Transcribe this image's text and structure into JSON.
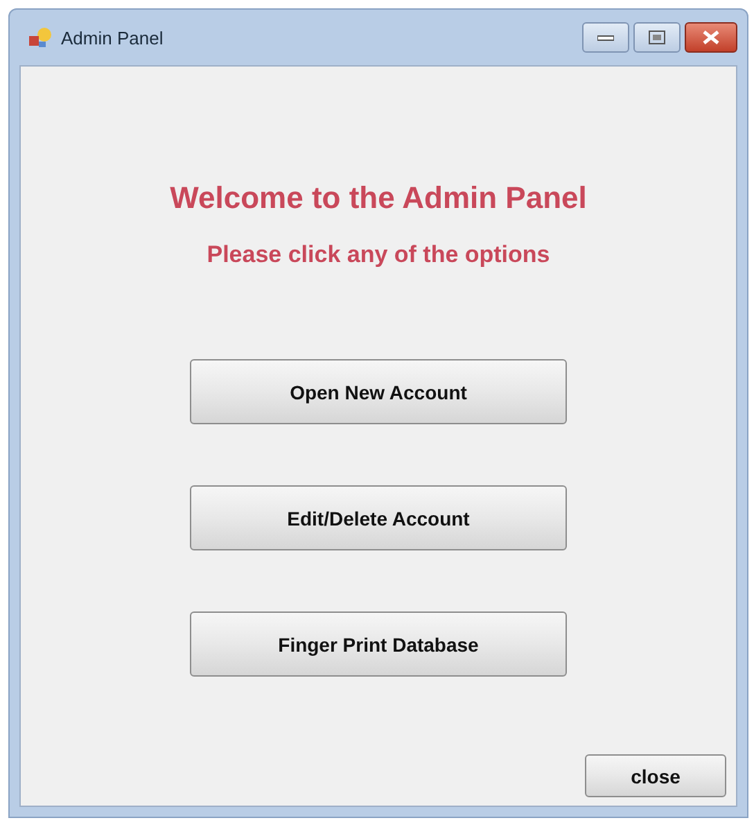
{
  "window": {
    "title": "Admin Panel"
  },
  "heading": "Welcome to the Admin Panel",
  "subheading": "Please click any of the options",
  "buttons": [
    {
      "label": "Open New Account"
    },
    {
      "label": "Edit/Delete Account"
    },
    {
      "label": "Finger Print Database"
    }
  ],
  "close_button": {
    "label": "close"
  }
}
